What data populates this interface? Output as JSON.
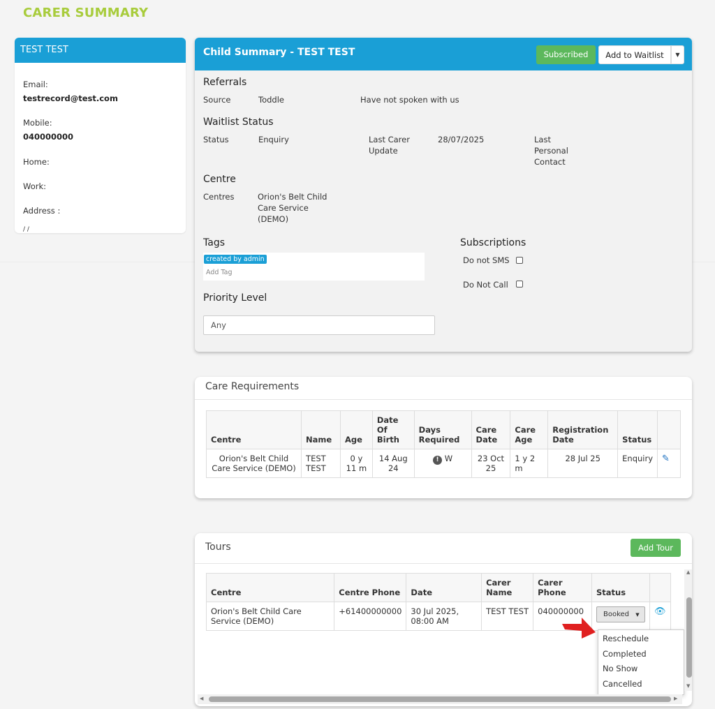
{
  "page_title": "CARER SUMMARY",
  "carer": {
    "name": "TEST TEST",
    "email_label": "Email:",
    "email": "testrecord@test.com",
    "mobile_label": "Mobile:",
    "mobile": "040000000",
    "home_label": "Home:",
    "work_label": "Work:",
    "address_label": "Address :",
    "address_value": "/ /"
  },
  "child_summary": {
    "title": "Child Summary - TEST TEST",
    "subscribed_label": "Subscribed",
    "waitlist_label": "Add to Waitlist",
    "referrals": {
      "heading": "Referrals",
      "source_label": "Source",
      "source_value": "Toddle",
      "note": "Have not spoken with us"
    },
    "waitlist": {
      "heading": "Waitlist Status",
      "status_label": "Status",
      "status_value": "Enquiry",
      "last_carer_update_label": "Last Carer Update",
      "last_carer_update_value": "28/07/2025",
      "last_personal_contact_label": "Last Personal Contact"
    },
    "centre": {
      "heading": "Centre",
      "centres_label": "Centres",
      "centres_value": "Orion's Belt Child Care Service (DEMO)"
    },
    "tags": {
      "heading": "Tags",
      "tag": "created by admin",
      "add_tag_placeholder": "Add Tag"
    },
    "subscriptions": {
      "heading": "Subscriptions",
      "do_not_sms": "Do not SMS",
      "do_not_call": "Do Not Call"
    },
    "priority": {
      "heading": "Priority Level",
      "value": "Any"
    }
  },
  "care_requirements": {
    "title": "Care Requirements",
    "columns": [
      "Centre",
      "Name",
      "Age",
      "Date Of Birth",
      "Days Required",
      "Care Date",
      "Care Age",
      "Registration Date",
      "Status"
    ],
    "rows": [
      {
        "centre": "Orion's Belt Child Care Service (DEMO)",
        "name": "TEST TEST",
        "age": "0 y 11 m",
        "dob": "14 Aug 24",
        "days": "W",
        "care_date": "23 Oct 25",
        "care_age": "1 y 2 m",
        "registration": "28 Jul 25",
        "status": "Enquiry"
      }
    ]
  },
  "tours": {
    "title": "Tours",
    "add_label": "Add Tour",
    "columns": [
      "Centre",
      "Centre Phone",
      "Date",
      "Carer Name",
      "Carer Phone",
      "Status"
    ],
    "rows": [
      {
        "centre": "Orion's Belt Child Care Service (DEMO)",
        "phone": "+61400000000",
        "date": "30 Jul 2025, 08:00 AM",
        "carer_name": "TEST TEST",
        "carer_phone": "040000000",
        "status": "Booked"
      }
    ],
    "status_options": [
      "Reschedule",
      "Completed",
      "No Show",
      "Cancelled"
    ]
  },
  "colors": {
    "primary": "#1a9fd6",
    "success": "#5cb85c",
    "title_green": "#a8cc3c",
    "arrow": "#e02020"
  }
}
